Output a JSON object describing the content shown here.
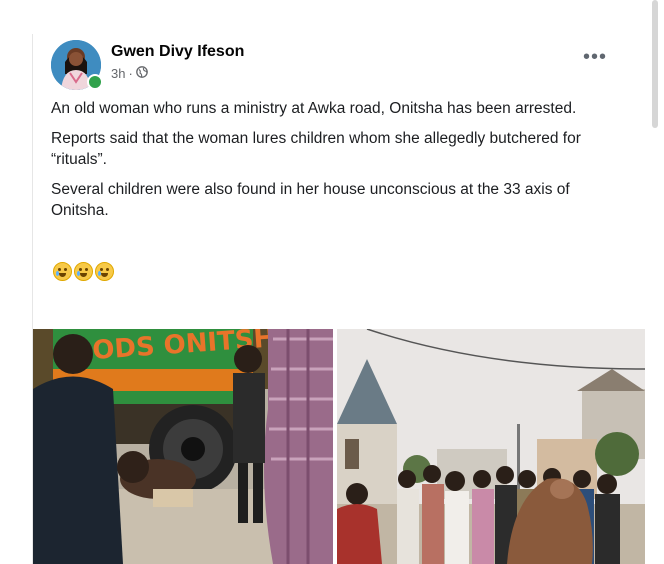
{
  "post": {
    "author": "Gwen Divy Ifeson",
    "time": "3h",
    "separator": "·",
    "more": "•••",
    "paragraphs": [
      "An old woman who runs a ministry at Awka road, Onitsha has been arrested.",
      "Reports said that the woman lures children whom she allegedly butchered for “rituals”.",
      "Several children were also found in her house unconscious at the 33 axis of Onitsha."
    ],
    "emojis": [
      "crying-face",
      "crying-face",
      "crying-face"
    ],
    "truck_text": "ODS ONITSH"
  },
  "icons": {
    "privacy": "globe-icon",
    "options": "more-options-icon"
  }
}
